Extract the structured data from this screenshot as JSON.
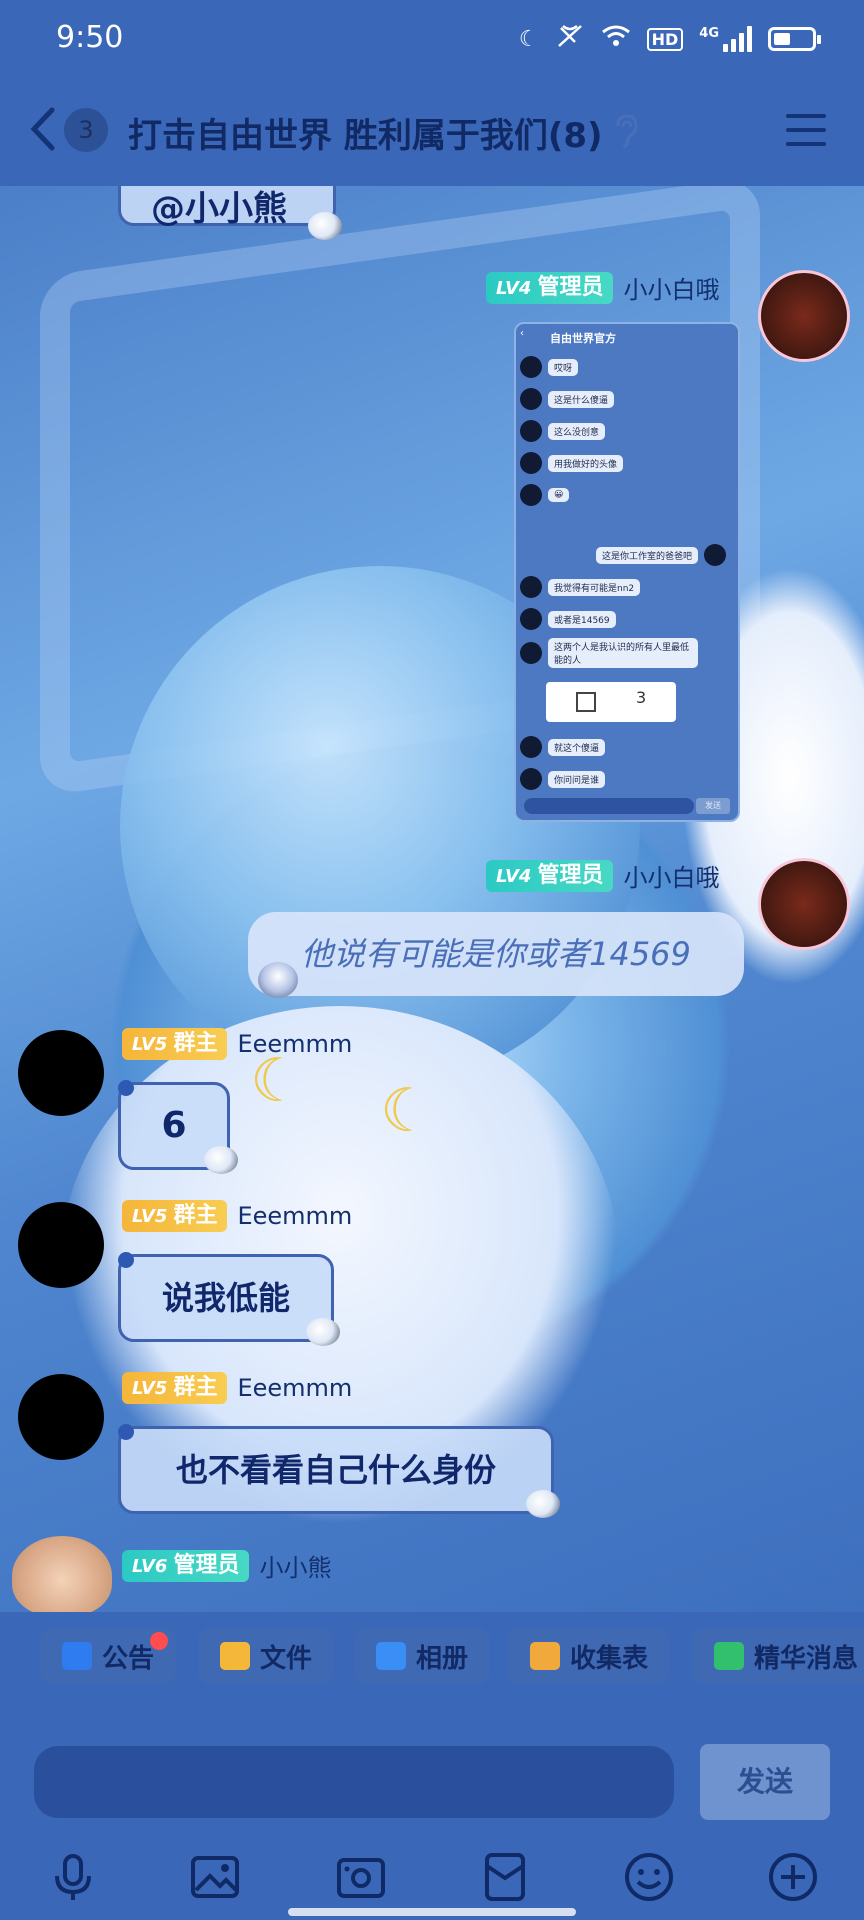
{
  "status_bar": {
    "time": "9:50",
    "hd": "HD",
    "network": "4G"
  },
  "header": {
    "unread_count": "3",
    "title": "打击自由世界 胜利属于我们(8)"
  },
  "messages": [
    {
      "type": "partial",
      "text": "@小小熊"
    },
    {
      "side": "right",
      "badge_level": "LV4",
      "badge_role": "管理员",
      "name": "小小白哦",
      "kind": "image"
    },
    {
      "side": "right",
      "badge_level": "LV4",
      "badge_role": "管理员",
      "name": "小小白哦",
      "text": "他说有可能是你或者14569"
    },
    {
      "side": "left",
      "badge_level": "LV5",
      "badge_role": "群主",
      "name": "Eeemmm",
      "text": "6"
    },
    {
      "side": "left",
      "badge_level": "LV5",
      "badge_role": "群主",
      "name": "Eeemmm",
      "text": "说我低能"
    },
    {
      "side": "left",
      "badge_level": "LV5",
      "badge_role": "群主",
      "name": "Eeemmm",
      "text": "也不看看自己什么身份"
    },
    {
      "side": "left",
      "badge_level": "LV6",
      "badge_role": "管理员",
      "name": "小小熊"
    }
  ],
  "embedded_screenshot": {
    "title": "自由世界官方",
    "messages": [
      "哎呀",
      "这是什么傻逼",
      "这么没创意",
      "用我做好的头像",
      "😀",
      "这是你工作室的爸爸吧",
      "我觉得有可能是nn2",
      "或者是14569",
      "这两个人是我认识的所有人里最低能的人",
      "就这个傻逼",
      "你问问是谁"
    ],
    "card_number": "3",
    "send": "发送"
  },
  "tools": [
    "公告",
    "文件",
    "相册",
    "收集表",
    "精华消息"
  ],
  "input": {
    "send": "发送"
  },
  "colors": {
    "bar": "#3a67b8",
    "admin_badge": "#2cc9c4",
    "owner_badge": "#f5b53a",
    "notify_dot": "#ff4d4f"
  }
}
